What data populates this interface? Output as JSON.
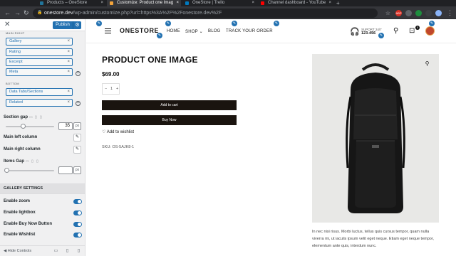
{
  "browser": {
    "tabs": [
      {
        "label": "Products – OneStore",
        "active": false,
        "fav_color": "#21759b"
      },
      {
        "label": "Customize: Product one Imag",
        "active": true,
        "fav_color": "#f2a33a"
      },
      {
        "label": "OneStore | Trello",
        "active": false,
        "fav_color": "#0079bf"
      },
      {
        "label": "Channel dashboard - YouTube",
        "active": false,
        "fav_color": "#ff0000"
      }
    ],
    "url_host": "onestore.dev",
    "url_path": "/wp-admin/customize.php?url=https%3A%2F%2Fonestore.dev%2F",
    "extensions": [
      "ABP",
      "",
      "",
      "",
      ""
    ]
  },
  "customizer": {
    "publish_label": "Publish",
    "main_right_label": "MAIN RIGHT",
    "main_right_items": [
      "Gallery",
      "Rating",
      "Excerpt",
      "Meta"
    ],
    "bottom_label": "BOTTOM",
    "bottom_items": [
      "Data Tabs/Sections",
      "Related"
    ],
    "section_gap_label": "Section gap",
    "section_gap_value": "35",
    "section_gap_unit": "px",
    "section_gap_fraction": 0.35,
    "main_left_label": "Main left column",
    "main_right_column_label": "Main right column",
    "items_gap_label": "Items Gap",
    "items_gap_value": "",
    "items_gap_unit": "px",
    "gallery_settings_label": "GALLERY SETTINGS",
    "toggles": [
      {
        "label": "Enable zoom",
        "on": true
      },
      {
        "label": "Enable lightbox",
        "on": true
      },
      {
        "label": "Enable Buy Now Button",
        "on": true
      },
      {
        "label": "Enable Wishlist",
        "on": true
      }
    ],
    "hide_controls_label": "Hide Controls"
  },
  "site": {
    "logo": "ONESTORE",
    "menu": [
      "HOME",
      "SHOP",
      "BLOG",
      "TRACK YOUR ORDER"
    ],
    "support_line1": "SUPORT 24/7",
    "support_line2": "123-456",
    "cart_count": "0"
  },
  "product": {
    "title": "PRODUCT ONE IMAGE",
    "price": "$69.00",
    "qty": "1",
    "add_to_cart": "Add to cart",
    "buy_now": "Buy Now",
    "wishlist": "Add to wishlist",
    "sku": "SKU: OS-5AJK8-1",
    "description": "In nec nisi risus. Morbi luctus, tellus quis cursus tempor, quam nulla viverra mi, ut iaculis ipsum velit eget neque. Etiam eget neque tempor, elementum ante quis, interdum nunc."
  }
}
